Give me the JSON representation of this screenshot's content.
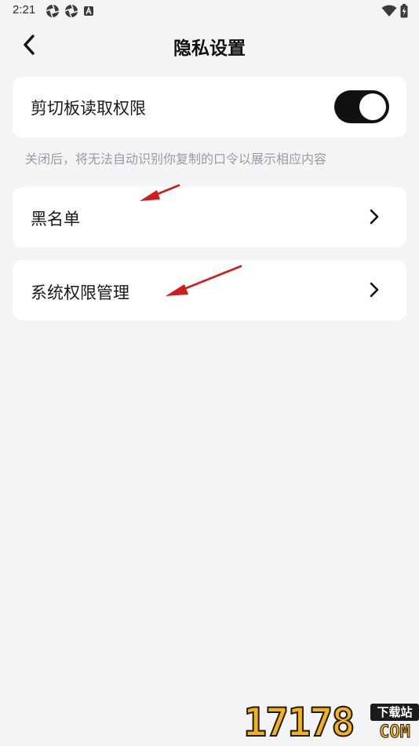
{
  "status_bar": {
    "time": "2:21",
    "left_icons": [
      "aperture-icon",
      "aperture-icon",
      "a-badge-icon"
    ],
    "right_icons": [
      "wifi-icon",
      "battery-charging-icon"
    ]
  },
  "header": {
    "title": "隐私设置",
    "back_icon": "chevron-left-icon"
  },
  "settings": {
    "clipboard": {
      "label": "剪切板读取权限",
      "enabled": true,
      "hint": "关闭后，将无法自动识别你复制的口令以展示相应内容"
    },
    "blacklist": {
      "label": "黑名单"
    },
    "system_permissions": {
      "label": "系统权限管理"
    }
  },
  "annotations": {
    "arrow_color": "#d21c1c"
  },
  "watermark": {
    "digits": "17178",
    "badge": "下载站",
    "suffix": "COM"
  },
  "colors": {
    "background": "#f3f4f6",
    "card": "#ffffff",
    "toggle_on": "#111111",
    "hint": "#9a9ca3"
  }
}
